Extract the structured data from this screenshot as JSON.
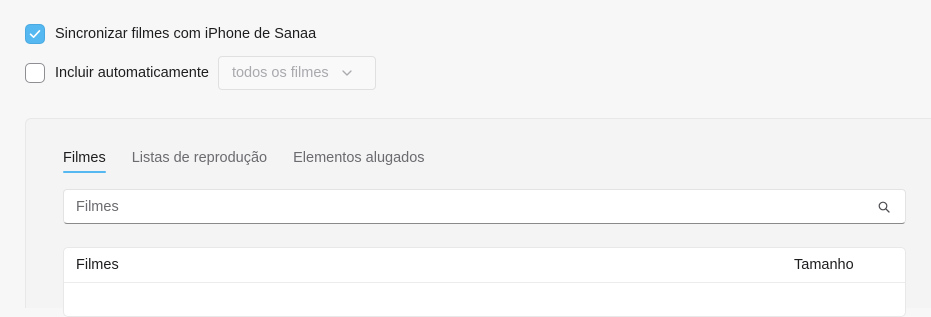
{
  "sync": {
    "label": "Sincronizar filmes com iPhone de Sanaa",
    "checked": true
  },
  "auto_include": {
    "label": "Incluir automaticamente",
    "checked": false,
    "select_value": "todos os filmes"
  },
  "tabs": [
    {
      "label": "Filmes",
      "active": true
    },
    {
      "label": "Listas de reprodução",
      "active": false
    },
    {
      "label": "Elementos alugados",
      "active": false
    }
  ],
  "search": {
    "placeholder": "Filmes",
    "icon": "search-icon"
  },
  "table": {
    "columns": [
      "Filmes",
      "Tamanho"
    ]
  },
  "colors": {
    "accent": "#55b8f0",
    "background": "#f7f7f7"
  }
}
